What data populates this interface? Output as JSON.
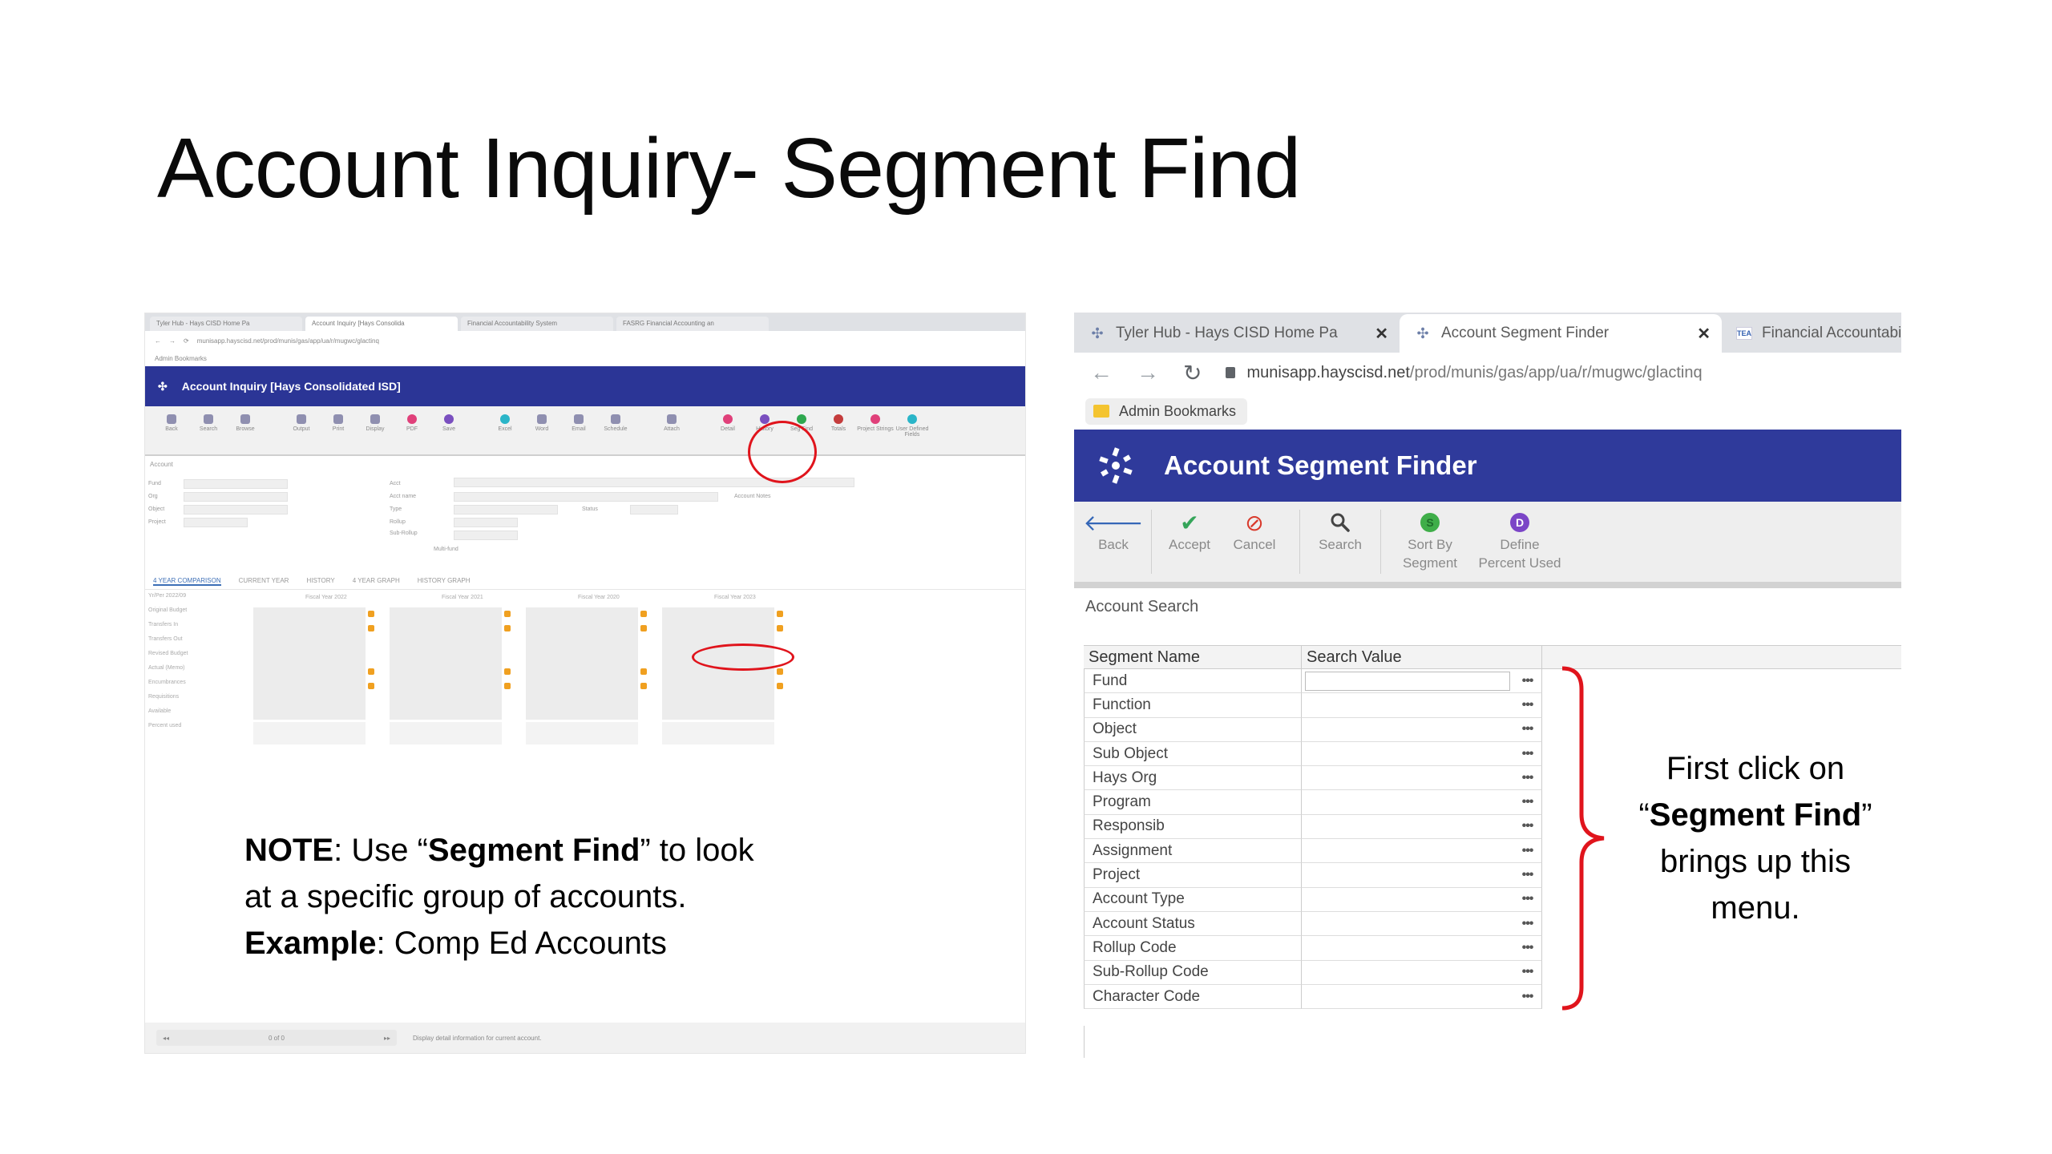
{
  "slide": {
    "title": "Account Inquiry- Segment Find"
  },
  "left_screenshot": {
    "tabs": [
      "Tyler Hub - Hays CISD Home Pa",
      "Account Inquiry [Hays Consolida",
      "Financial Accountability System",
      "FASRG Financial Accounting an"
    ],
    "url": "munisapp.hayscisd.net/prod/munis/gas/app/ua/r/mugwc/glactinq",
    "bookmarks_label": "Admin Bookmarks",
    "header_title": "Account Inquiry [Hays Consolidated ISD]",
    "toolbar": [
      "Back",
      "Search",
      "Browse",
      "Output",
      "Print",
      "Display",
      "PDF",
      "Save",
      "Excel",
      "Word",
      "Email",
      "Schedule",
      "Attach",
      "Detail",
      "History",
      "Seg Find",
      "Totals",
      "Project Strings",
      "User Defined Fields"
    ],
    "section_label": "Account",
    "form_labels": [
      "Fund",
      "Org",
      "Object",
      "Project",
      "Acct",
      "Acct name",
      "Type",
      "Rollup",
      "Sub-Rollup",
      "Status",
      "Account Notes",
      "Multi-fund"
    ],
    "subtabs": [
      "4 YEAR COMPARISON",
      "CURRENT YEAR",
      "HISTORY",
      "4 YEAR GRAPH",
      "HISTORY GRAPH"
    ],
    "columns": [
      "Fiscal Year 2022",
      "Fiscal Year 2021",
      "Fiscal Year 2020",
      "Fiscal Year 2023"
    ],
    "row_labels": [
      "Yr/Per 2022/09",
      "Original Budget",
      "Transfers In",
      "Transfers Out",
      "Revised Budget",
      "Actual (Memo)",
      "Encumbrances",
      "Requisitions",
      "Available",
      "Percent used"
    ],
    "pager": "0 of 0",
    "status_text": "Display detail information for current account."
  },
  "note": {
    "prefix_bold": "NOTE",
    "line1_a": ": Use “",
    "line1_bold": "Segment Find",
    "line1_b": "” to look",
    "line2": "at a specific group of accounts.",
    "example_bold": "Example",
    "example_text": ": Comp Ed Accounts"
  },
  "right_screenshot": {
    "tabs": [
      {
        "label": "Tyler Hub - Hays CISD Home Pa",
        "close": "✕"
      },
      {
        "label": "Account Segment Finder",
        "close": "✕"
      },
      {
        "label": "Financial Accountabili",
        "close": ""
      }
    ],
    "tea_badge": "TEA",
    "url_host": "munisapp.hayscisd.net",
    "url_path": "/prod/munis/gas/app/ua/r/mugwc/glactinq",
    "bookmarks_label": "Admin Bookmarks",
    "header_title": "Account Segment Finder",
    "toolbar": {
      "back": "Back",
      "accept": "Accept",
      "cancel": "Cancel",
      "search": "Search",
      "sort_l1": "Sort By",
      "sort_l2": "Segment",
      "define_l1": "Define",
      "define_l2": "Percent Used",
      "sort_badge": "S",
      "define_badge": "D"
    },
    "section_label": "Account Search",
    "table": {
      "headers": [
        "Segment Name",
        "Search Value"
      ],
      "rows": [
        "Fund",
        "Function",
        "Object",
        "Sub Object",
        "Hays Org",
        "Program",
        "Responsib",
        "Assignment",
        "Project",
        "Account Type",
        "Account Status",
        "Rollup Code",
        "Sub-Rollup Code",
        "Character Code"
      ],
      "lookup": "•••"
    }
  },
  "callout": {
    "line1": "First click on",
    "quote_open": "“",
    "bold": "Segment Find",
    "quote_close": "”",
    "line3": "brings up this",
    "line4": "menu."
  },
  "colors": {
    "header_blue": "#2f3a9b",
    "highlight_red": "#e0141c"
  }
}
